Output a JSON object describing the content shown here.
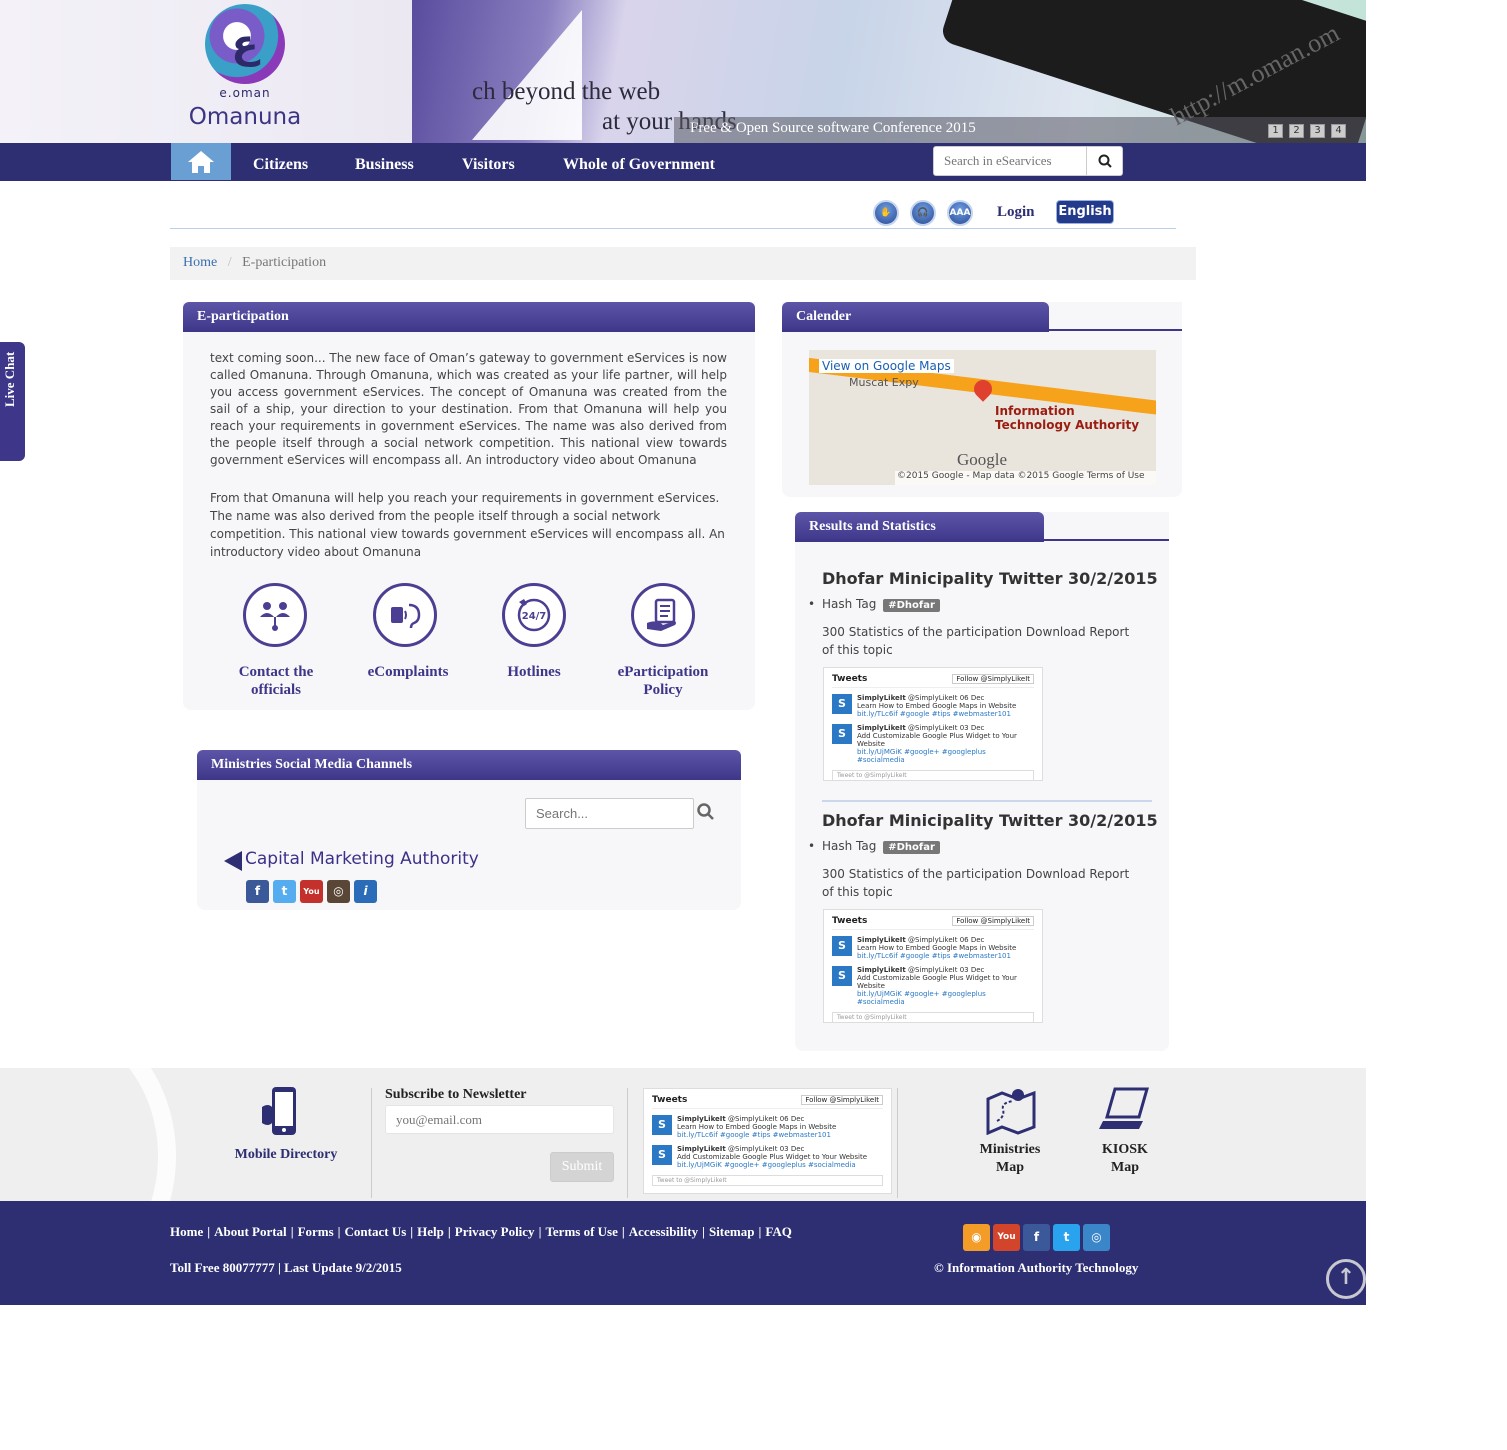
{
  "header": {
    "logo_sub": "e.oman",
    "logo_name": "Omanuna",
    "hero_line1": "ch beyond the web",
    "hero_line2": "at your hands",
    "hero_url": "http://m.oman.om",
    "hero_caption": "Free & Open Source software Conference 2015",
    "slider_pages": [
      "1",
      "2",
      "3",
      "4"
    ]
  },
  "nav": {
    "home_icon": "home-icon",
    "items": [
      "Citizens",
      "Business",
      "Visitors",
      "Whole of Government"
    ],
    "search_placeholder": "Search in eSearvices"
  },
  "utility": {
    "icons": [
      "sign-language-icon",
      "headphones-icon",
      "font-size-icon"
    ],
    "font_icon_text": "AAA",
    "login": "Login",
    "language": "English"
  },
  "breadcrumb": {
    "home": "Home",
    "separator": "/",
    "current": "E-participation"
  },
  "eparticipation": {
    "title": "E-participation",
    "paragraph1": "text coming soon... The new face of Oman’s gateway to government eServices is now called Omanuna. Through Omanuna, which was created as your life partner, will help you access government eServices. The concept of Omanuna was created from the sail of a ship, your direction to your destination. From that Omanuna will help you reach your requirements in government eServices. The name was also derived from the people itself through a social network competition. This national view towards government eServices will encompass all. An introductory video about Omanuna",
    "paragraph2": "From that Omanuna will help you reach your requirements in government eServices. The name was also derived from the people itself through a social network competition. This national view towards government eServices will encompass all. An introductory video about Omanuna",
    "services": [
      {
        "label_line1": "Contact the",
        "label_line2": "officials",
        "icon": "people-network-icon"
      },
      {
        "label_line1": "eComplaints",
        "label_line2": "",
        "icon": "ear-complaint-icon"
      },
      {
        "label_line1": "Hotlines",
        "label_line2": "",
        "icon": "phone-24-7-icon"
      },
      {
        "label_line1": "eParticipation",
        "label_line2": "Policy",
        "icon": "policy-document-icon"
      }
    ]
  },
  "calendar": {
    "title": "Calender",
    "map_link": "View on Google Maps",
    "map_road": "Muscat Expy",
    "map_place_line1": "Information",
    "map_place_line2": "Technology Authority",
    "map_brand": "Google",
    "map_footer": "©2015 Google - Map data ©2015 Google    Terms of Use"
  },
  "results": {
    "title": "Results and Statistics",
    "entries": [
      {
        "heading": "Dhofar Minicipality Twitter 30/2/2015",
        "hash_label": "Hash Tag",
        "hash_badge": "#Dhofar",
        "stat": "300 Statistics of the participation Download Report of this topic"
      },
      {
        "heading": "Dhofar Minicipality Twitter 30/2/2015",
        "hash_label": "Hash Tag",
        "hash_badge": "#Dhofar",
        "stat": "300 Statistics of the participation Download Report of this topic"
      }
    ]
  },
  "tweet_widget": {
    "title": "Tweets",
    "follow": "Follow @SimplyLikeIt",
    "rows": [
      {
        "user": "SimplyLikeIt",
        "handle": "@SimplyLikeIt",
        "date": "06 Dec",
        "text": "Learn How to Embed Google Maps in Website",
        "link": "bit.ly/TLc6if #google #tips #webmaster101"
      },
      {
        "user": "SimplyLikeIt",
        "handle": "@SimplyLikeIt",
        "date": "03 Dec",
        "text": "Add Customizable Google Plus Widget to Your Website",
        "link": "bit.ly/UjMGiK #google+ #googleplus #socialmedia"
      }
    ],
    "compose": "Tweet to @SimplyLikeIt"
  },
  "social_media": {
    "title": "Ministries Social Media Channels",
    "search_placeholder": "Search...",
    "ministry": "Capital Marketing Authority",
    "channels": [
      {
        "name": "facebook-icon",
        "glyph": "f",
        "color": "#3b5998"
      },
      {
        "name": "twitter-icon",
        "glyph": "t",
        "color": "#55acee"
      },
      {
        "name": "youtube-icon",
        "glyph": "You",
        "color": "#c4302b"
      },
      {
        "name": "instagram-icon",
        "glyph": "◎",
        "color": "#5a4636"
      },
      {
        "name": "info-icon",
        "glyph": "i",
        "color": "#2b6cb8"
      }
    ]
  },
  "footer_band": {
    "mobile_directory": "Mobile Directory",
    "newsletter_title": "Subscribe to Newsletter",
    "newsletter_placeholder": "you@email.com",
    "newsletter_submit": "Submit",
    "ministries_map_line1": "Ministries",
    "ministries_map_line2": "Map",
    "kiosk_map_line1": "KIOSK",
    "kiosk_map_line2": "Map"
  },
  "footer": {
    "links": [
      "Home",
      "About Portal",
      "Forms",
      "Contact Us",
      "Help",
      "Privacy Policy",
      "Terms of Use",
      "Accessibility",
      "Sitemap",
      "FAQ"
    ],
    "info": "Toll Free 80077777 | Last Update 9/2/2015",
    "copyright": "© Information Authority Technology",
    "social": [
      {
        "name": "rss-icon",
        "glyph": "◉",
        "color": "#f39c28"
      },
      {
        "name": "youtube-icon",
        "glyph": "You",
        "color": "#d2452b"
      },
      {
        "name": "facebook-icon",
        "glyph": "f",
        "color": "#3b5998"
      },
      {
        "name": "twitter-icon",
        "glyph": "t",
        "color": "#2aa3ef"
      },
      {
        "name": "instagram-icon",
        "glyph": "◎",
        "color": "#3a86c8"
      }
    ]
  },
  "live_chat": "Live Chat",
  "colors": {
    "brand_navy": "#2e2f73",
    "panel_purple": "#3d3689",
    "home_tab": "#6a9fd4"
  }
}
